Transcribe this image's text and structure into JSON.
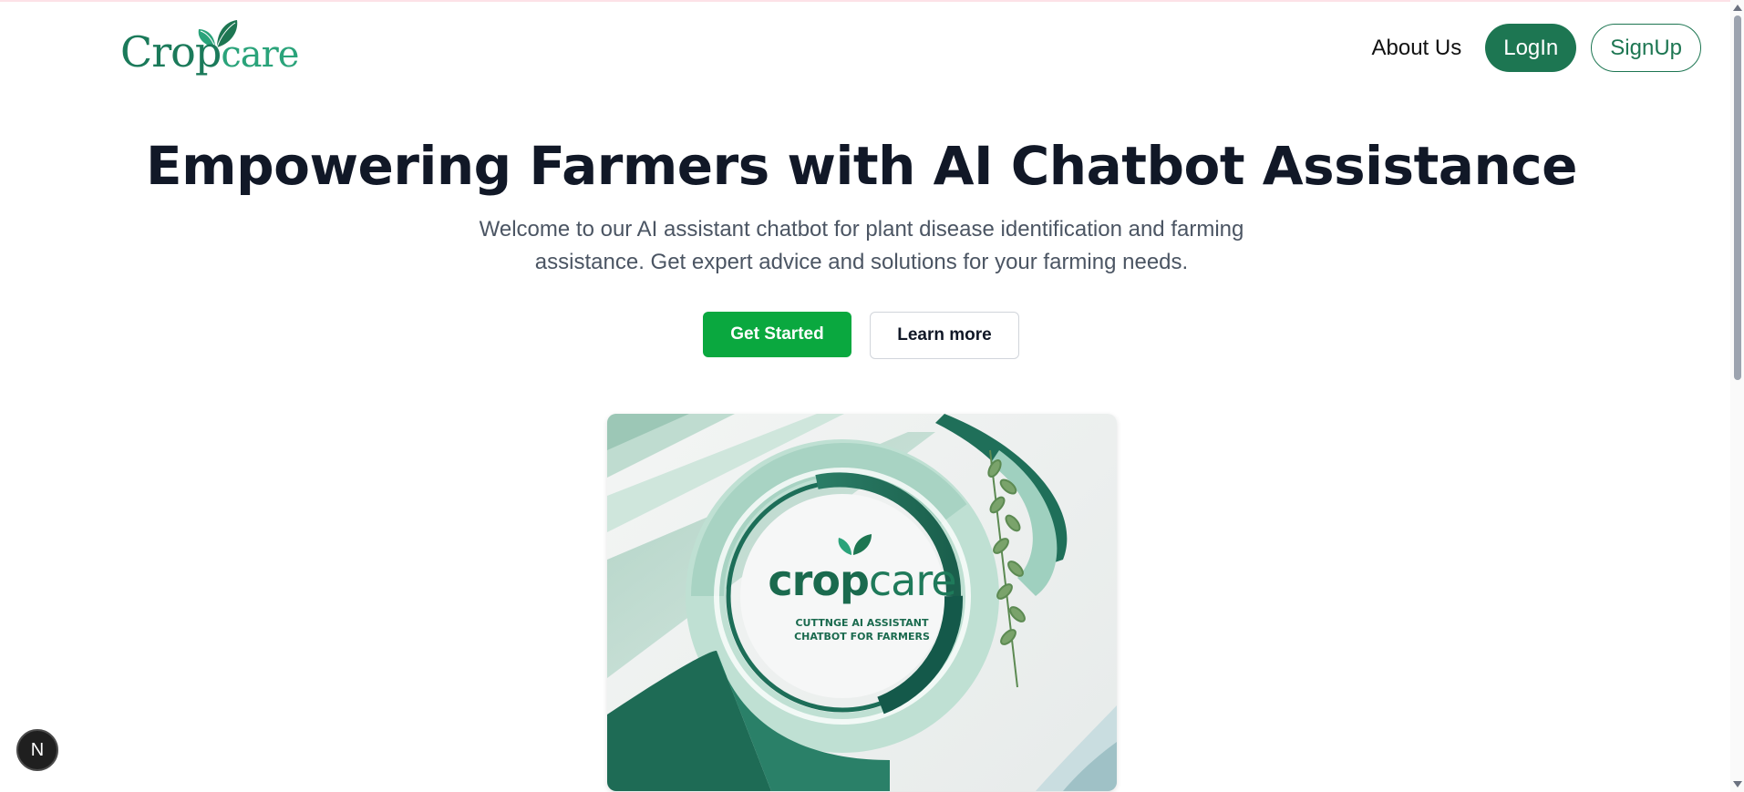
{
  "brand": {
    "logo_word1": "Crop",
    "logo_word2": "care",
    "color_primary": "#1d7652",
    "color_accent": "#0aa83f"
  },
  "nav": {
    "about_label": "About Us",
    "login_label": "LogIn",
    "signup_label": "SignUp"
  },
  "hero": {
    "title": "Empowering Farmers with AI Chatbot Assistance",
    "subtitle": "Welcome to our AI assistant chatbot for plant disease identification and farming assistance. Get expert advice and solutions for your farming needs.",
    "primary_cta": "Get Started",
    "secondary_cta": "Learn more"
  },
  "hero_image": {
    "brand_word1": "crop",
    "brand_word2": "care",
    "tagline": "CUTTNGE AI ASSISTANT\nCHATBOT FOR FARMERS"
  },
  "dev_badge": {
    "letter": "N"
  }
}
